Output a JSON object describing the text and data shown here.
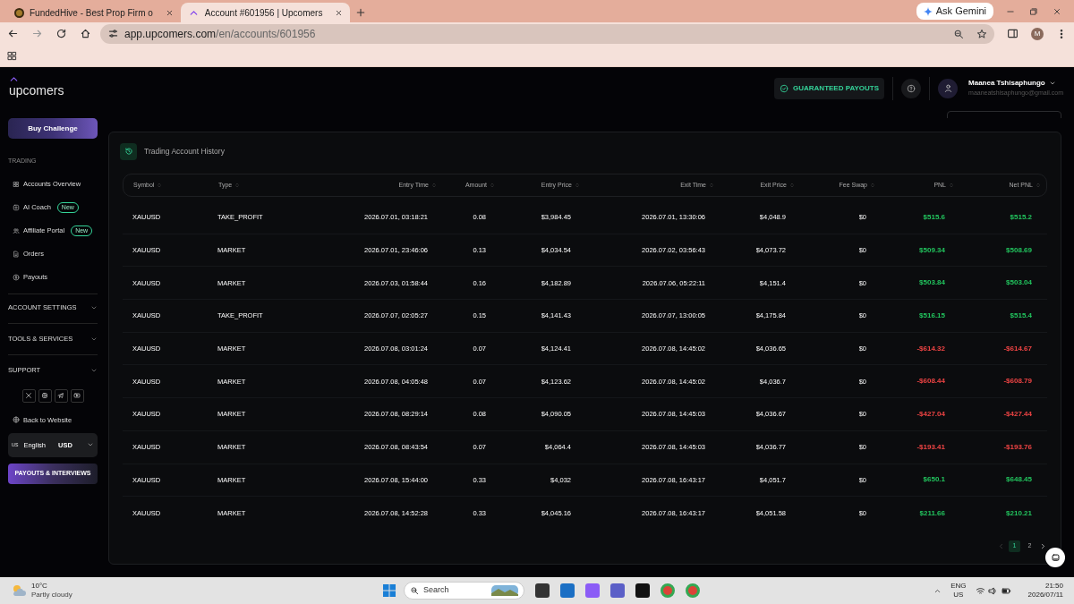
{
  "browser": {
    "tabs": [
      {
        "title": "FundedHive - Best Prop Firm o",
        "selected": false
      },
      {
        "title": "Account #601956 | Upcomers",
        "selected": true
      }
    ],
    "ask_button": "Ask Gemini",
    "url_host": "app.upcomers.com",
    "url_path": "/en/accounts/601956",
    "profile_initial": "M"
  },
  "header": {
    "logo": "upcomers",
    "guarantee_button": "GUARANTEED PAYOUTS",
    "user_name": "Maanea Tshisaphungo",
    "user_email": "maaneatshisaphungo@gmail.com"
  },
  "sidebar": {
    "buy_button": "Buy Challenge",
    "section_label": "TRADING",
    "items": [
      {
        "label": "Accounts Overview"
      },
      {
        "label": "AI Coach",
        "badge": "New"
      },
      {
        "label": "Affiliate Portal",
        "badge": "New"
      },
      {
        "label": "Orders"
      },
      {
        "label": "Payouts"
      }
    ],
    "groups": [
      {
        "label": "ACCOUNT SETTINGS",
        "expanded": false
      },
      {
        "label": "TOOLS & SERVICES",
        "expanded": false
      },
      {
        "label": "SUPPORT",
        "expanded": false
      }
    ],
    "back_link": "Back to Website",
    "language_flag": "us",
    "language": "English",
    "currency": "USD",
    "promo_button": "PAYOUTS & INTERVIEWS"
  },
  "card_title": "Trading Account History",
  "table": {
    "columns": [
      "Symbol",
      "Type",
      "Entry Time",
      "Amount",
      "Entry Price",
      "Exit Time",
      "Exit Price",
      "Fee Swap",
      "PNL",
      "Net PNL"
    ],
    "rows": [
      {
        "color": "#22c55e",
        "cells": [
          "XAUUSD",
          "TAKE_PROFIT",
          "2026.07.01, 03:18:21",
          "0.08",
          "$3,984.45",
          "2026.07.01, 13:30:06",
          "$4,048.9",
          "$0",
          "$515.6",
          "$515.2"
        ]
      },
      {
        "color": "#22c55e",
        "cells": [
          "XAUUSD",
          "MARKET",
          "2026.07.01, 23:46:06",
          "0.13",
          "$4,034.54",
          "2026.07.02, 03:56:43",
          "$4,073.72",
          "$0",
          "$509.34",
          "$508.69"
        ]
      },
      {
        "color": "#22c55e",
        "cells": [
          "XAUUSD",
          "MARKET",
          "2026.07.03, 01:58:44",
          "0.16",
          "$4,182.89",
          "2026.07.06, 05:22:11",
          "$4,151.4",
          "$0",
          "$503.84",
          "$503.04"
        ]
      },
      {
        "color": "#22c55e",
        "cells": [
          "XAUUSD",
          "TAKE_PROFIT",
          "2026.07.07, 02:05:27",
          "0.15",
          "$4,141.43",
          "2026.07.07, 13:00:05",
          "$4,175.84",
          "$0",
          "$516.15",
          "$515.4"
        ]
      },
      {
        "color": "#ef4444",
        "cells": [
          "XAUUSD",
          "MARKET",
          "2026.07.08, 03:01:24",
          "0.07",
          "$4,124.41",
          "2026.07.08, 14:45:02",
          "$4,036.65",
          "$0",
          "-$614.32",
          "-$614.67"
        ]
      },
      {
        "color": "#ef4444",
        "cells": [
          "XAUUSD",
          "MARKET",
          "2026.07.08, 04:05:48",
          "0.07",
          "$4,123.62",
          "2026.07.08, 14:45:02",
          "$4,036.7",
          "$0",
          "-$608.44",
          "-$608.79"
        ]
      },
      {
        "color": "#ef4444",
        "cells": [
          "XAUUSD",
          "MARKET",
          "2026.07.08, 08:29:14",
          "0.08",
          "$4,090.05",
          "2026.07.08, 14:45:03",
          "$4,036.67",
          "$0",
          "-$427.04",
          "-$427.44"
        ]
      },
      {
        "color": "#ef4444",
        "cells": [
          "XAUUSD",
          "MARKET",
          "2026.07.08, 08:43:54",
          "0.07",
          "$4,064.4",
          "2026.07.08, 14:45:03",
          "$4,036.77",
          "$0",
          "-$193.41",
          "-$193.76"
        ]
      },
      {
        "color": "#22c55e",
        "cells": [
          "XAUUSD",
          "MARKET",
          "2026.07.08, 15:44:00",
          "0.33",
          "$4,032",
          "2026.07.08, 16:43:17",
          "$4,051.7",
          "$0",
          "$650.1",
          "$648.45"
        ]
      },
      {
        "color": "#22c55e",
        "cells": [
          "XAUUSD",
          "MARKET",
          "2026.07.08, 14:52:28",
          "0.33",
          "$4,045.16",
          "2026.07.08, 16:43:17",
          "$4,051.58",
          "$0",
          "$211.66",
          "$210.21"
        ]
      }
    ]
  },
  "pagination": [
    {
      "label": "1",
      "selected": true
    },
    {
      "label": "2",
      "selected": false
    }
  ],
  "taskbar": {
    "temperature": "10°C",
    "weather": "Partly cloudy",
    "search": "Search",
    "lang_top": "ENG",
    "lang_bottom": "US",
    "time": "21:50",
    "date": "2026/07/11"
  }
}
